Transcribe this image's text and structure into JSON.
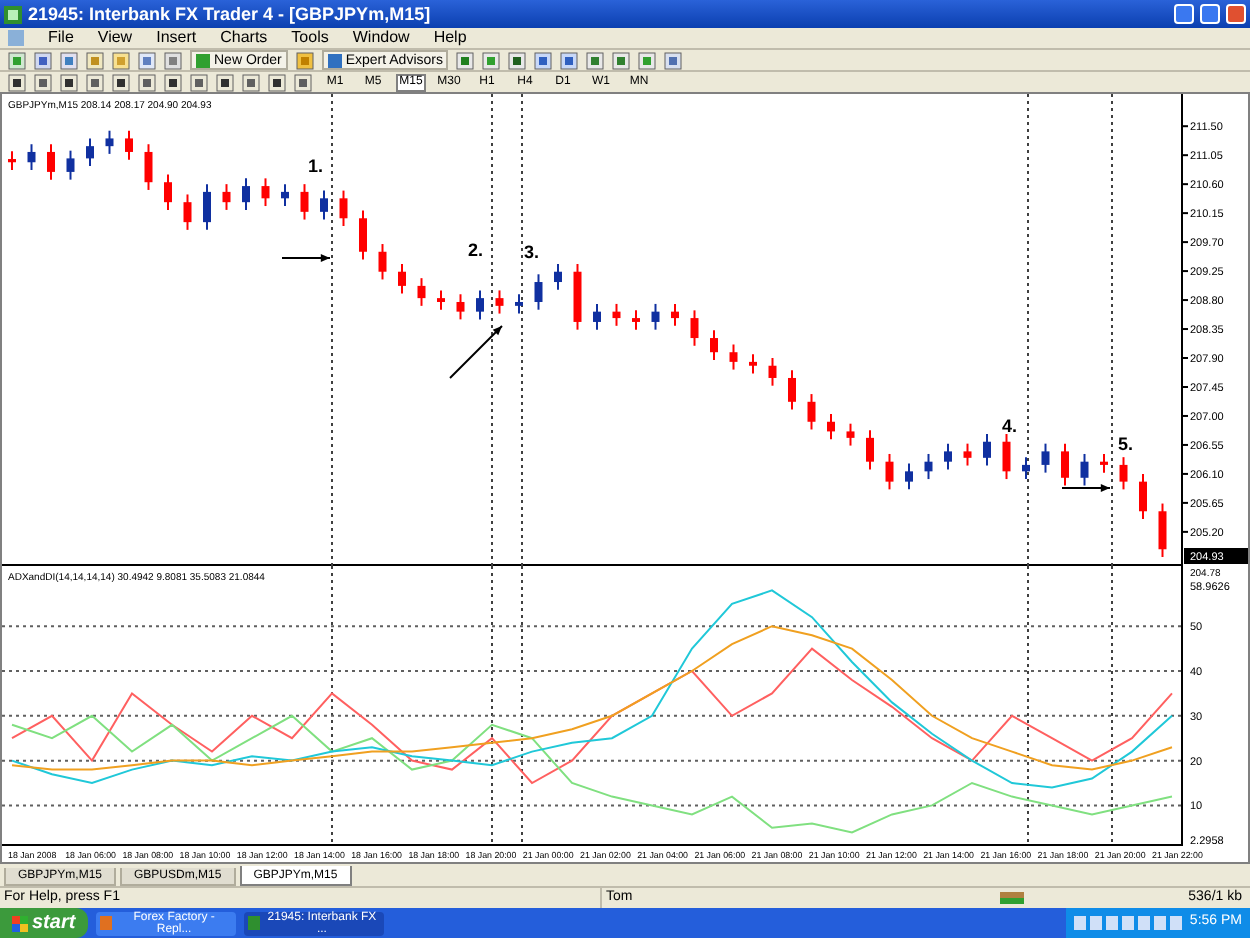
{
  "window": {
    "title": "21945: Interbank FX Trader 4 - [GBPJPYm,M15]"
  },
  "menu": [
    "File",
    "View",
    "Insert",
    "Charts",
    "Tools",
    "Window",
    "Help"
  ],
  "toolbar": {
    "buttons": [
      {
        "label": "New Order"
      },
      {
        "label": "Expert Advisors"
      }
    ]
  },
  "timeframes": [
    {
      "label": "M1",
      "selected": false
    },
    {
      "label": "M5",
      "selected": false
    },
    {
      "label": "M15",
      "selected": true
    },
    {
      "label": "M30",
      "selected": false
    },
    {
      "label": "H1",
      "selected": false
    },
    {
      "label": "H4",
      "selected": false
    },
    {
      "label": "D1",
      "selected": false
    },
    {
      "label": "W1",
      "selected": false
    },
    {
      "label": "MN",
      "selected": false
    }
  ],
  "chart": {
    "header": "GBPJPYm,M15  208.14 208.17 204.90 204.93",
    "current_price": "204.93",
    "last_label": "204.78",
    "marks": [
      "1.",
      "2.",
      "3.",
      "4.",
      "5."
    ],
    "chart_data": {
      "type": "candlestick",
      "categories": [
        null,
        null,
        null,
        null,
        null,
        null,
        null,
        null,
        null,
        null,
        null,
        null,
        null,
        null,
        null,
        null,
        null,
        null,
        null,
        null,
        null,
        null,
        null,
        null,
        null,
        null,
        null,
        null,
        null,
        null,
        null,
        null,
        null,
        null,
        null,
        null,
        null,
        null,
        null,
        null,
        null,
        null,
        null,
        null,
        null,
        null,
        null,
        null,
        null,
        null,
        null,
        null,
        null,
        null,
        null,
        null,
        null,
        null,
        null,
        null
      ],
      "ohlc": [
        [
          210.99,
          211.11,
          210.82,
          210.94
        ],
        [
          210.94,
          211.22,
          210.82,
          211.1
        ],
        [
          211.1,
          211.22,
          210.67,
          210.79
        ],
        [
          210.79,
          211.12,
          210.67,
          211.0
        ],
        [
          211.0,
          211.31,
          210.88,
          211.19
        ],
        [
          211.19,
          211.43,
          211.07,
          211.31
        ],
        [
          211.31,
          211.43,
          210.98,
          211.1
        ],
        [
          211.1,
          211.22,
          210.51,
          210.63
        ],
        [
          210.63,
          210.75,
          210.2,
          210.32
        ],
        [
          210.32,
          210.44,
          209.89,
          210.01
        ],
        [
          210.01,
          210.6,
          209.89,
          210.48
        ],
        [
          210.48,
          210.6,
          210.2,
          210.32
        ],
        [
          210.32,
          210.69,
          210.2,
          210.57
        ],
        [
          210.57,
          210.69,
          210.26,
          210.38
        ],
        [
          210.38,
          210.6,
          210.26,
          210.48
        ],
        [
          210.48,
          210.6,
          210.05,
          210.17
        ],
        [
          210.17,
          210.5,
          210.05,
          210.38
        ],
        [
          210.38,
          210.5,
          209.95,
          210.07
        ],
        [
          210.07,
          210.19,
          209.43,
          209.55
        ],
        [
          209.55,
          209.67,
          209.12,
          209.24
        ],
        [
          209.24,
          209.36,
          208.9,
          209.02
        ],
        [
          209.02,
          209.14,
          208.71,
          208.83
        ],
        [
          208.83,
          208.95,
          208.65,
          208.77
        ],
        [
          208.77,
          208.89,
          208.5,
          208.62
        ],
        [
          208.62,
          208.95,
          208.5,
          208.83
        ],
        [
          208.83,
          208.95,
          208.59,
          208.71
        ],
        [
          208.71,
          208.89,
          208.59,
          208.77
        ],
        [
          208.77,
          209.2,
          208.65,
          209.08
        ],
        [
          209.08,
          209.36,
          208.96,
          209.24
        ],
        [
          209.24,
          209.36,
          208.34,
          208.46
        ],
        [
          208.46,
          208.74,
          208.34,
          208.62
        ],
        [
          208.62,
          208.74,
          208.4,
          208.52
        ],
        [
          208.52,
          208.64,
          208.34,
          208.46
        ],
        [
          208.46,
          208.74,
          208.34,
          208.62
        ],
        [
          208.62,
          208.74,
          208.4,
          208.52
        ],
        [
          208.52,
          208.64,
          208.09,
          208.21
        ],
        [
          208.21,
          208.33,
          207.87,
          207.99
        ],
        [
          207.99,
          208.11,
          207.72,
          207.84
        ],
        [
          207.84,
          207.96,
          207.66,
          207.78
        ],
        [
          207.78,
          207.9,
          207.47,
          207.59
        ],
        [
          207.59,
          207.71,
          207.1,
          207.22
        ],
        [
          207.22,
          207.34,
          206.79,
          206.91
        ],
        [
          206.91,
          207.03,
          206.64,
          206.76
        ],
        [
          206.76,
          206.88,
          206.54,
          206.66
        ],
        [
          206.66,
          206.78,
          206.17,
          206.29
        ],
        [
          206.29,
          206.41,
          205.86,
          205.98
        ],
        [
          205.98,
          206.26,
          205.86,
          206.14
        ],
        [
          206.14,
          206.41,
          206.02,
          206.29
        ],
        [
          206.29,
          206.57,
          206.17,
          206.45
        ],
        [
          206.45,
          206.57,
          206.23,
          206.35
        ],
        [
          206.35,
          206.72,
          206.23,
          206.6
        ],
        [
          206.6,
          206.72,
          206.02,
          206.14
        ],
        [
          206.14,
          206.36,
          206.02,
          206.24
        ],
        [
          206.24,
          206.57,
          206.12,
          206.45
        ],
        [
          206.45,
          206.57,
          205.92,
          206.04
        ],
        [
          206.04,
          206.41,
          205.92,
          206.29
        ],
        [
          206.29,
          206.41,
          206.12,
          206.24
        ],
        [
          206.24,
          206.36,
          205.86,
          205.98
        ],
        [
          205.98,
          206.1,
          205.4,
          205.52
        ],
        [
          205.52,
          205.64,
          204.81,
          204.93
        ]
      ],
      "ylim": [
        204.67,
        212.0
      ],
      "yticks": [
        {
          "value": 211.5,
          "label": "211.50"
        },
        {
          "value": 211.05,
          "label": "211.05"
        },
        {
          "value": 210.6,
          "label": "210.60"
        },
        {
          "value": 210.15,
          "label": "210.15"
        },
        {
          "value": 209.7,
          "label": "209.70"
        },
        {
          "value": 209.25,
          "label": "209.25"
        },
        {
          "value": 208.8,
          "label": "208.80"
        },
        {
          "value": 208.35,
          "label": "208.35"
        },
        {
          "value": 207.9,
          "label": "207.90"
        },
        {
          "value": 207.45,
          "label": "207.45"
        },
        {
          "value": 207.0,
          "label": "207.00"
        },
        {
          "value": 206.55,
          "label": "206.55"
        },
        {
          "value": 206.1,
          "label": "206.10"
        },
        {
          "value": 205.65,
          "label": "205.65"
        },
        {
          "value": 205.2,
          "label": "205.20"
        }
      ]
    }
  },
  "indicator": {
    "header": "ADXandDI(14,14,14,14) 30.4942 9.8081 35.5083 21.0844",
    "chart_data": {
      "type": "line",
      "series": [
        {
          "color": "#ff6060",
          "values": [
            25,
            30,
            20,
            35,
            28,
            22,
            30,
            25,
            35,
            28,
            20,
            18,
            25,
            15,
            20,
            30,
            35,
            40,
            30,
            35,
            45,
            38,
            32,
            25,
            20,
            30,
            25,
            20,
            25,
            35
          ]
        },
        {
          "color": "#80e080",
          "values": [
            28,
            25,
            30,
            22,
            28,
            20,
            25,
            30,
            22,
            25,
            18,
            20,
            28,
            25,
            15,
            12,
            10,
            8,
            12,
            5,
            6,
            4,
            8,
            10,
            15,
            12,
            10,
            8,
            10,
            12
          ]
        },
        {
          "color": "#20c8d8",
          "values": [
            20,
            17,
            15,
            18,
            20,
            19,
            21,
            20,
            22,
            23,
            21,
            20,
            19,
            22,
            24,
            25,
            30,
            45,
            55,
            58,
            52,
            42,
            33,
            26,
            20,
            15,
            14,
            16,
            22,
            30
          ]
        },
        {
          "color": "#f0a020",
          "values": [
            19,
            18,
            18,
            19,
            20,
            20,
            19,
            20,
            21,
            22,
            22,
            23,
            24,
            25,
            27,
            30,
            35,
            40,
            46,
            50,
            48,
            45,
            38,
            30,
            25,
            22,
            19,
            18,
            20,
            23
          ]
        }
      ],
      "ylim": [
        0.96,
        63.43
      ],
      "grid": true,
      "yticks": [
        {
          "value": 58.9626,
          "label": "58.9626"
        },
        50,
        40,
        30,
        20,
        10,
        {
          "value": 2.2958,
          "label": "2.2958"
        }
      ]
    }
  },
  "time_axis": [
    "18 Jan 2008",
    "18 Jan 06:00",
    "18 Jan 08:00",
    "18 Jan 10:00",
    "18 Jan 12:00",
    "18 Jan 14:00",
    "18 Jan 16:00",
    "18 Jan 18:00",
    "18 Jan 20:00",
    "21 Jan 00:00",
    "21 Jan 02:00",
    "21 Jan 04:00",
    "21 Jan 06:00",
    "21 Jan 08:00",
    "21 Jan 10:00",
    "21 Jan 12:00",
    "21 Jan 14:00",
    "21 Jan 16:00",
    "21 Jan 18:00",
    "21 Jan 20:00",
    "21 Jan 22:00"
  ],
  "tabs": [
    {
      "label": "GBPJPYm,M15",
      "selected": false
    },
    {
      "label": "GBPUSDm,M15",
      "selected": false
    },
    {
      "label": "GBPJPYm,M15",
      "selected": true
    }
  ],
  "status_bar": {
    "help": "For Help, press F1",
    "profile": "Tom",
    "traffic": "536/1 kb"
  },
  "taskbar": {
    "start": "start",
    "tasks": [
      {
        "label": "Forex Factory - Repl...",
        "selected": false
      },
      {
        "label": "21945: Interbank FX ...",
        "selected": true
      }
    ],
    "clock": "5:56 PM"
  }
}
